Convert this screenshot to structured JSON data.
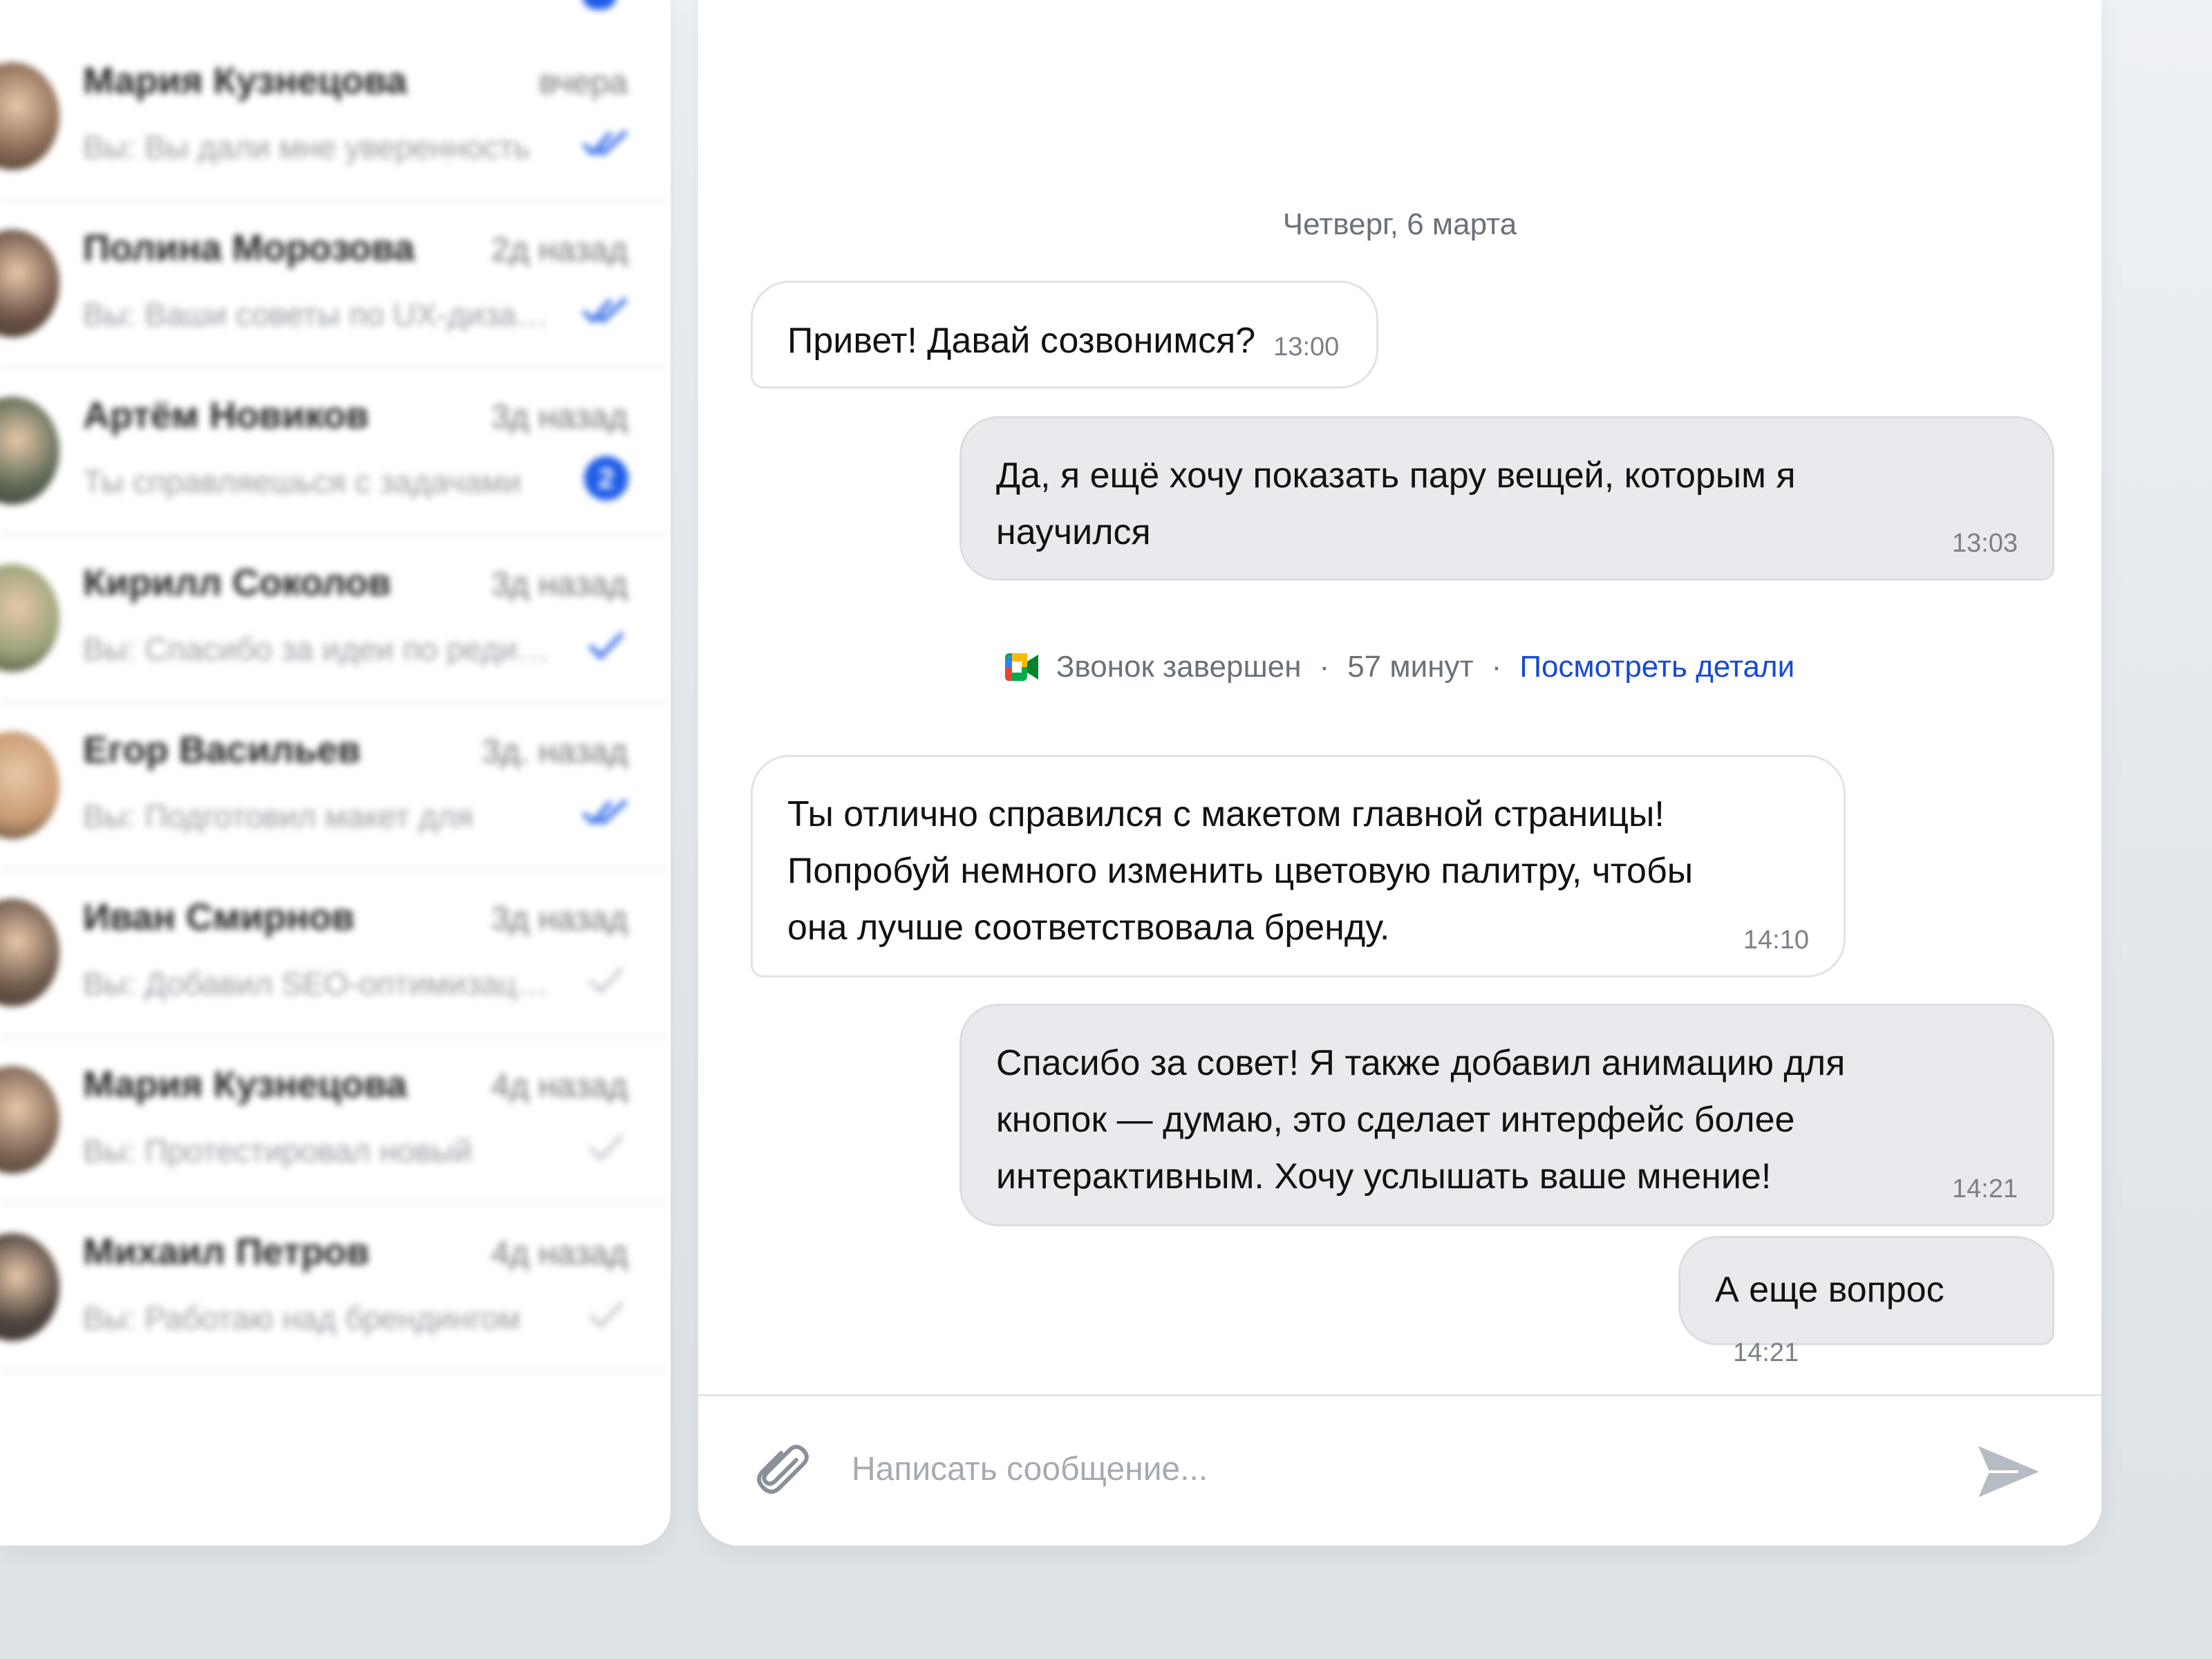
{
  "conversations": [
    {
      "name": "Мария Кузнецова",
      "time": "вчера",
      "preview": "Вы: Вы дали мне уверенность",
      "status": "read",
      "avatar_color": "#8a6a55"
    },
    {
      "name": "Полина Морозова",
      "time": "2д назад",
      "preview": "Вы: Ваши советы по UX-дизайну",
      "status": "read",
      "avatar_color": "#6d5447"
    },
    {
      "name": "Артём Новиков",
      "time": "3д назад",
      "preview": "Ты справляешься с задачами",
      "status": "unread",
      "unread_count": "2",
      "avatar_color": "#5d6b57"
    },
    {
      "name": "Кирилл Соколов",
      "time": "3д назад",
      "preview": "Вы: Спасибо за идеи по редизайну",
      "status": "sent",
      "avatar_color": "#9aa37a"
    },
    {
      "name": "Егор Васильев",
      "time": "3д. назад",
      "preview": "Вы: Подготовил макет для",
      "status": "read",
      "avatar_color": "#c79a72"
    },
    {
      "name": "Иван Смирнов",
      "time": "3д назад",
      "preview": "Вы: Добавил SEO-оптимизацию",
      "status": "sent-grey",
      "avatar_color": "#6e5a4c"
    },
    {
      "name": "Мария Кузнецова",
      "time": "4д назад",
      "preview": "Вы: Протестировал новый",
      "status": "sent-grey",
      "avatar_color": "#7e6656"
    },
    {
      "name": "Михаил Петров",
      "time": "4д назад",
      "preview": "Вы: Работаю над брендингом",
      "status": "sent-grey",
      "avatar_color": "#4f4540"
    }
  ],
  "chat": {
    "date_separator": "Четверг, 6 марта",
    "messages": [
      {
        "direction": "in",
        "text": "Привет! Давай созвонимся?",
        "time": "13:00"
      },
      {
        "direction": "out",
        "text": "Да, я ещё хочу показать пару вещей, которым я научился",
        "time": "13:03"
      },
      {
        "direction": "in",
        "text": "Ты отлично справился с макетом главной страницы! Попробуй немного изменить цветовую палитру, чтобы она лучше соответствовала бренду.",
        "time": "14:10"
      },
      {
        "direction": "out",
        "text": "Спасибо за совет! Я также добавил анимацию для кнопок — думаю, это сделает интерфейс более интерактивным. Хочу услышать ваше мнение!",
        "time": "14:21"
      },
      {
        "direction": "out",
        "text": "А еще вопрос",
        "time": "14:21"
      }
    ],
    "call": {
      "status": "Звонок завершен",
      "separator": "·",
      "duration": "57 минут",
      "details_link": "Посмотреть детали"
    },
    "composer": {
      "placeholder": "Написать сообщение...",
      "value": ""
    }
  },
  "colors": {
    "accent": "#1f5de8",
    "link": "#1549d6",
    "bubble_out": "#e9eaee",
    "bubble_in_border": "#dfe2e6"
  },
  "icons": {
    "attach": "paperclip-icon",
    "send": "send-icon",
    "call": "google-meet-icon",
    "read": "double-check-icon",
    "sent": "check-icon"
  }
}
